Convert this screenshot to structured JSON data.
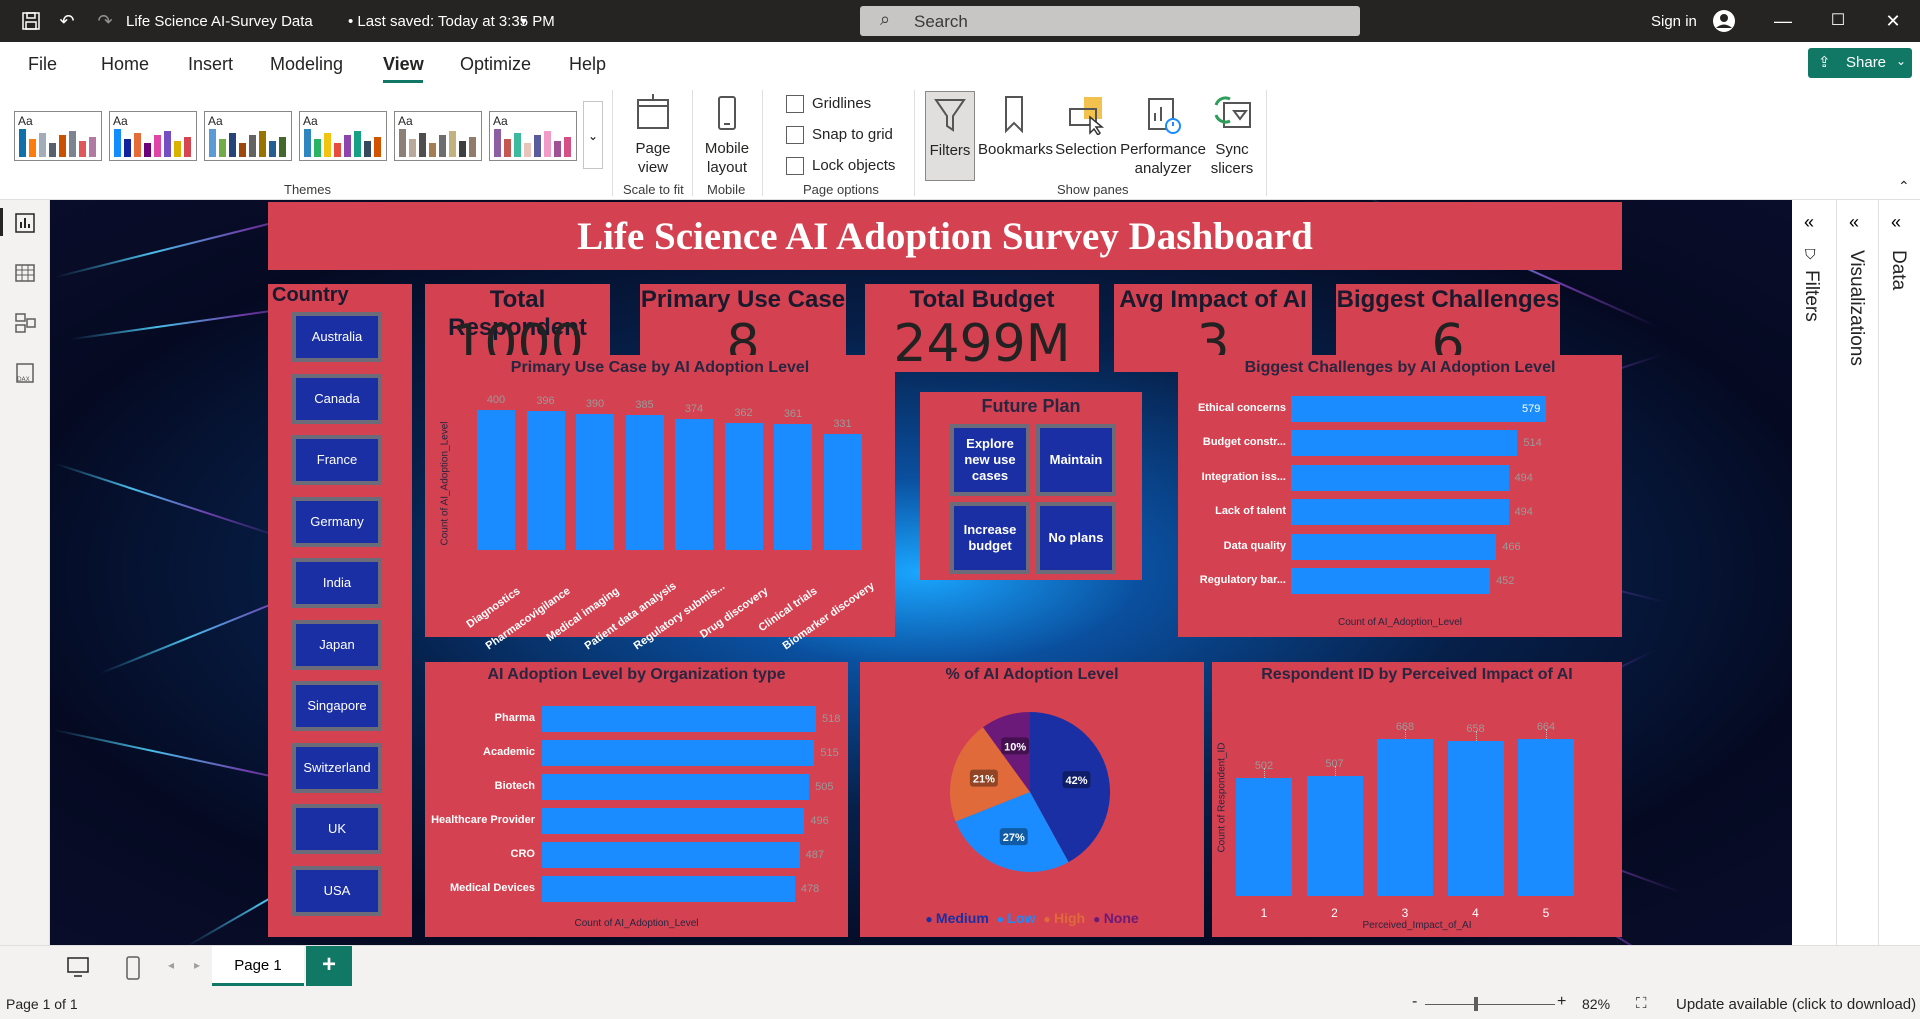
{
  "window": {
    "doc_title": "Life Science AI-Survey Data",
    "saved_status": "• Last saved: Today at 3:35 PM",
    "search_placeholder": "Search",
    "signin_label": "Sign in"
  },
  "ribbon_tabs": [
    "File",
    "Home",
    "Insert",
    "Modeling",
    "View",
    "Optimize",
    "Help"
  ],
  "active_tab": "View",
  "share_label": "Share",
  "ribbon": {
    "themes_label": "Themes",
    "theme_aa": "Aa",
    "page_view": "Page view",
    "scale_to_fit": "Scale to fit",
    "mobile_layout": "Mobile layout",
    "mobile": "Mobile",
    "gridlines": "Gridlines",
    "snap_to_grid": "Snap to grid",
    "lock_objects": "Lock objects",
    "page_options": "Page options",
    "filters": "Filters",
    "bookmarks": "Bookmarks",
    "selection": "Selection",
    "performance_analyzer": "Performance analyzer",
    "sync_slicers": "Sync slicers",
    "show_panes": "Show panes"
  },
  "panes": {
    "filters": "Filters",
    "visualizations": "Visualizations",
    "data": "Data"
  },
  "pagebar": {
    "page_tab": "Page 1",
    "add": "+"
  },
  "statusbar": {
    "page_info": "Page 1 of 1",
    "zoom": "82%",
    "update": "Update available (click to download)",
    "minus": "-",
    "plus": "+"
  },
  "dashboard": {
    "title": "Life Science AI Adoption Survey Dashboard",
    "country_title": "Country",
    "countries": [
      "Australia",
      "Canada",
      "France",
      "Germany",
      "India",
      "Japan",
      "Singapore",
      "Switzerland",
      "UK",
      "USA"
    ],
    "cards": [
      {
        "title": "Total Respondent",
        "value": "1000"
      },
      {
        "title": "Primary Use Case",
        "value": "8"
      },
      {
        "title": "Total Budget",
        "value": "2499M"
      },
      {
        "title": "Avg Impact of AI",
        "value": "3"
      },
      {
        "title": "Biggest Challenges",
        "value": "6"
      }
    ],
    "future_plan_title": "Future Plan",
    "future_plans": [
      "Explore new use cases",
      "Maintain",
      "Increase budget",
      "No plans"
    ]
  },
  "chart_data": [
    {
      "type": "bar",
      "title": "Primary Use Case by AI Adoption Level",
      "ylabel": "Count of AI_Adoption_Level",
      "xlabel": "",
      "categories": [
        "Diagnostics",
        "Pharmacovigilance",
        "Medical imaging",
        "Patient data analysis",
        "Regulatory submis...",
        "Drug discovery",
        "Clinical trials",
        "Biomarker discovery"
      ],
      "values": [
        400,
        396,
        390,
        385,
        374,
        362,
        361,
        331
      ],
      "ylim": [
        0,
        400
      ]
    },
    {
      "type": "bar",
      "title": "Biggest Challenges by AI Adoption Level",
      "xlabel": "Count of AI_Adoption_Level",
      "orientation": "horizontal",
      "categories": [
        "Ethical concerns",
        "Budget constr...",
        "Integration iss...",
        "Lack of talent",
        "Data quality",
        "Regulatory bar..."
      ],
      "values": [
        579,
        514,
        494,
        494,
        466,
        452
      ],
      "xlim": [
        0,
        579
      ]
    },
    {
      "type": "bar",
      "title": "AI Adoption Level by Organization type",
      "xlabel": "Count of AI_Adoption_Level",
      "orientation": "horizontal",
      "categories": [
        "Pharma",
        "Academic",
        "Biotech",
        "Healthcare Provider",
        "CRO",
        "Medical Devices"
      ],
      "values": [
        518,
        515,
        505,
        496,
        487,
        478
      ],
      "xlim": [
        0,
        518
      ]
    },
    {
      "type": "pie",
      "title": "% of AI Adoption Level",
      "labels": [
        "Medium",
        "Low",
        "High",
        "None"
      ],
      "values": [
        42,
        27,
        21,
        10
      ],
      "colors": [
        "#1a2fa3",
        "#1a8cff",
        "#e06a3a",
        "#6b1a7a"
      ],
      "legend": "bottom"
    },
    {
      "type": "bar",
      "title": "Respondent ID by Perceived Impact of AI",
      "xlabel": "Perceived_Impact_of_AI",
      "ylabel": "Count of Respondent_ID",
      "categories": [
        "1",
        "2",
        "3",
        "4",
        "5"
      ],
      "values": [
        502,
        507,
        668,
        658,
        664
      ],
      "ylim": [
        0,
        700
      ]
    }
  ]
}
